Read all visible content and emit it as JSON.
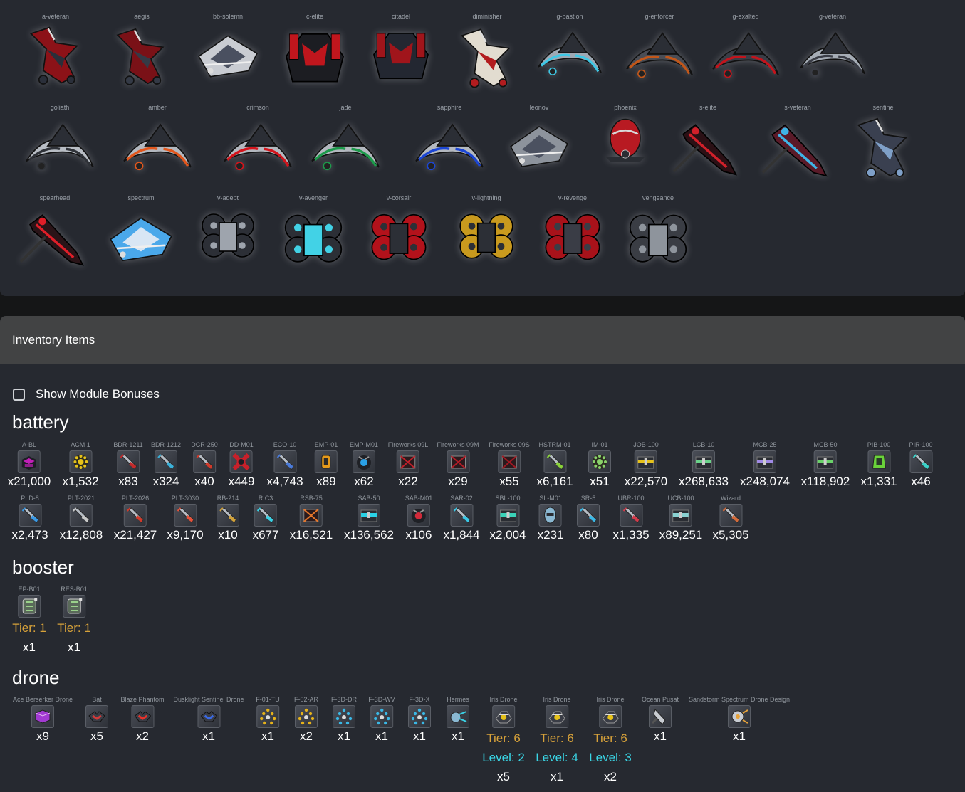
{
  "ships": [
    {
      "name": "a-veteran",
      "style": "fighter",
      "colors": [
        "#8c1218",
        "#2a2f3a"
      ]
    },
    {
      "name": "aegis",
      "style": "fighter",
      "colors": [
        "#7a1117",
        "#343a46"
      ]
    },
    {
      "name": "bb-solemn",
      "style": "cruiser",
      "colors": [
        "#c9ccd2",
        "#4a5060"
      ]
    },
    {
      "name": "c-elite",
      "style": "heavy",
      "colors": [
        "#1c1d22",
        "#c0161d"
      ]
    },
    {
      "name": "citadel",
      "style": "heavy",
      "colors": [
        "#232731",
        "#a0151b"
      ]
    },
    {
      "name": "diminisher",
      "style": "fighter",
      "colors": [
        "#e2dcd0",
        "#b21c1f"
      ]
    },
    {
      "name": "g-bastion",
      "style": "crescent",
      "colors": [
        "#9ea9b4",
        "#3ec8e6"
      ]
    },
    {
      "name": "g-enforcer",
      "style": "crescent",
      "colors": [
        "#4a4d55",
        "#c2571a"
      ]
    },
    {
      "name": "g-exalted",
      "style": "crescent",
      "colors": [
        "#3a3d46",
        "#c3141c"
      ]
    },
    {
      "name": "g-veteran",
      "style": "crescent",
      "colors": [
        "#a5acb5",
        "#3a3d46"
      ]
    },
    {
      "name": "goliath",
      "style": "crescent",
      "colors": [
        "#b8bdc4",
        "#2f3238"
      ]
    },
    {
      "name": "amber",
      "style": "crescent",
      "colors": [
        "#b3b8bf",
        "#e2561c"
      ]
    },
    {
      "name": "crimson",
      "style": "crescent",
      "colors": [
        "#b3b8bf",
        "#d4141c"
      ]
    },
    {
      "name": "jade",
      "style": "crescent",
      "colors": [
        "#b3b8bf",
        "#1c9a4a"
      ]
    },
    {
      "name": "sapphire",
      "style": "crescent",
      "colors": [
        "#b3b8bf",
        "#1c46d4"
      ]
    },
    {
      "name": "leonov",
      "style": "cruiser",
      "colors": [
        "#8d939c",
        "#4b5160"
      ]
    },
    {
      "name": "phoenix",
      "style": "pod",
      "colors": [
        "#b81a22",
        "#d8d8d8"
      ]
    },
    {
      "name": "s-elite",
      "style": "spear",
      "colors": [
        "#2b1015",
        "#d0202a"
      ]
    },
    {
      "name": "s-veteran",
      "style": "spear",
      "colors": [
        "#5a1a28",
        "#3fb4e6"
      ]
    },
    {
      "name": "sentinel",
      "style": "fighter",
      "colors": [
        "#3a4050",
        "#7fa0c8"
      ]
    },
    {
      "name": "spearhead",
      "style": "spear",
      "colors": [
        "#2a1418",
        "#e01e28"
      ]
    },
    {
      "name": "spectrum",
      "style": "cruiser",
      "colors": [
        "#4aa8ea",
        "#d8e6f4"
      ]
    },
    {
      "name": "v-adept",
      "style": "cluster",
      "colors": [
        "#2c2f36",
        "#9ea4ad"
      ]
    },
    {
      "name": "v-avenger",
      "style": "cluster",
      "colors": [
        "#2c2f36",
        "#42d2e6"
      ]
    },
    {
      "name": "v-corsair",
      "style": "cluster",
      "colors": [
        "#b3121b",
        "#2c2f36"
      ]
    },
    {
      "name": "v-lightning",
      "style": "cluster",
      "colors": [
        "#c99a1e",
        "#2c2f36"
      ]
    },
    {
      "name": "v-revenge",
      "style": "cluster",
      "colors": [
        "#a8121a",
        "#3a3d46"
      ]
    },
    {
      "name": "vengeance",
      "style": "cluster",
      "colors": [
        "#3a3d44",
        "#8e949c"
      ]
    }
  ],
  "inventory": {
    "title": "Inventory Items",
    "module_bonus_label": "Show Module Bonuses",
    "categories": [
      {
        "title": "battery",
        "rows": [
          [
            {
              "name": "A-BL",
              "count": "x21,000",
              "icon": "box",
              "color": "#c21fb8"
            },
            {
              "name": "ACM 1",
              "count": "x1,532",
              "icon": "mine",
              "color": "#e6c21a"
            },
            {
              "name": "BDR-1211",
              "count": "x83",
              "icon": "rocket",
              "color": "#c42a2a"
            },
            {
              "name": "BDR-1212",
              "count": "x324",
              "icon": "rocket",
              "color": "#3ab0d8"
            },
            {
              "name": "DCR-250",
              "count": "x40",
              "icon": "rocket",
              "color": "#d23a2a"
            },
            {
              "name": "DD-M01",
              "count": "x449",
              "icon": "cross",
              "color": "#c8202a"
            },
            {
              "name": "ECO-10",
              "count": "x4,743",
              "icon": "rocket",
              "color": "#4a7ad8"
            },
            {
              "name": "EMP-01",
              "count": "x89",
              "icon": "grenade",
              "color": "#e69a1a"
            },
            {
              "name": "EMP-M01",
              "count": "x62",
              "icon": "orb",
              "color": "#2aa0e6"
            },
            {
              "name": "Fireworks 09L",
              "count": "x22",
              "icon": "crate",
              "color": "#c0202a"
            },
            {
              "name": "Fireworks 09M",
              "count": "x29",
              "icon": "crate",
              "color": "#b01c26"
            },
            {
              "name": "Fireworks 09S",
              "count": "x55",
              "icon": "crate",
              "color": "#a01822"
            },
            {
              "name": "HSTRM-01",
              "count": "x6,161",
              "icon": "rocket",
              "color": "#8ad23a"
            },
            {
              "name": "IM-01",
              "count": "x51",
              "icon": "mine",
              "color": "#8ad26a"
            },
            {
              "name": "JOB-100",
              "count": "x22,570",
              "icon": "chest",
              "color": "#e6c21a"
            },
            {
              "name": "LCB-10",
              "count": "x268,633",
              "icon": "chest",
              "color": "#6ad28a"
            },
            {
              "name": "MCB-25",
              "count": "x248,074",
              "icon": "chest",
              "color": "#a08ae6"
            },
            {
              "name": "MCB-50",
              "count": "x118,902",
              "icon": "chest",
              "color": "#6ad26a"
            },
            {
              "name": "PIB-100",
              "count": "x1,331",
              "icon": "cell",
              "color": "#6ad23a"
            },
            {
              "name": "PIR-100",
              "count": "x46",
              "icon": "rocket",
              "color": "#3ad2c8"
            }
          ],
          [
            {
              "name": "PLD-8",
              "count": "x2,473",
              "icon": "rocket",
              "color": "#3a9ae6"
            },
            {
              "name": "PLT-2021",
              "count": "x12,808",
              "icon": "rocket",
              "color": "#c8c8c8"
            },
            {
              "name": "PLT-2026",
              "count": "x21,427",
              "icon": "rocket",
              "color": "#d23a2a"
            },
            {
              "name": "PLT-3030",
              "count": "x9,170",
              "icon": "rocket",
              "color": "#e6523a"
            },
            {
              "name": "RB-214",
              "count": "x10",
              "icon": "rocket",
              "color": "#d2a23a"
            },
            {
              "name": "RIC3",
              "count": "x677",
              "icon": "rocket",
              "color": "#3ad2e6"
            },
            {
              "name": "RSB-75",
              "count": "x16,521",
              "icon": "crate",
              "color": "#e6762a"
            },
            {
              "name": "SAB-50",
              "count": "x136,562",
              "icon": "chest",
              "color": "#2ad2e6"
            },
            {
              "name": "SAB-M01",
              "count": "x106",
              "icon": "orb",
              "color": "#d22a3a"
            },
            {
              "name": "SAR-02",
              "count": "x1,844",
              "icon": "rocket",
              "color": "#3ac8e6"
            },
            {
              "name": "SBL-100",
              "count": "x2,004",
              "icon": "chest",
              "color": "#3ad2b8"
            },
            {
              "name": "SL-M01",
              "count": "x231",
              "icon": "pod",
              "color": "#8ab8d2"
            },
            {
              "name": "SR-5",
              "count": "x80",
              "icon": "rocket",
              "color": "#3ab8e6"
            },
            {
              "name": "UBR-100",
              "count": "x1,335",
              "icon": "rocket",
              "color": "#d23a4a"
            },
            {
              "name": "UCB-100",
              "count": "x89,251",
              "icon": "chest",
              "color": "#8ad2d2"
            },
            {
              "name": "Wizard",
              "count": "x5,305",
              "icon": "rocket",
              "color": "#d26a3a"
            }
          ]
        ]
      },
      {
        "title": "booster",
        "items": [
          {
            "name": "EP-B01",
            "tier": "Tier: 1",
            "count": "x1",
            "icon": "booster",
            "color": "#9ad28a"
          },
          {
            "name": "RES-B01",
            "tier": "Tier: 1",
            "count": "x1",
            "icon": "booster",
            "color": "#9ad28a"
          }
        ]
      },
      {
        "title": "drone",
        "items": [
          {
            "name": "Ace Berserker Drone",
            "count": "x9",
            "icon": "dronebox",
            "color": "#a23ad2"
          },
          {
            "name": "Bat",
            "count": "x5",
            "icon": "dronebat",
            "color": "#d23a3a"
          },
          {
            "name": "Blaze Phantom",
            "count": "x2",
            "icon": "dronebat",
            "color": "#e6322a"
          },
          {
            "name": "Dusklight Sentinel Drone",
            "count": "x1",
            "icon": "dronebat",
            "color": "#3a6ae6"
          },
          {
            "name": "F-01-TU",
            "count": "x1",
            "icon": "formation",
            "color": "#e6b21a"
          },
          {
            "name": "F-02-AR",
            "count": "x2",
            "icon": "formation",
            "color": "#e6b21a"
          },
          {
            "name": "F-3D-DR",
            "count": "x1",
            "icon": "formation",
            "color": "#3ab8e6"
          },
          {
            "name": "F-3D-WV",
            "count": "x1",
            "icon": "formation",
            "color": "#3ab8e6"
          },
          {
            "name": "F-3D-X",
            "count": "x1",
            "icon": "formation",
            "color": "#3ab8e6"
          },
          {
            "name": "Hermes",
            "count": "x1",
            "icon": "hermes",
            "color": "#3ad2e6"
          },
          {
            "name": "Iris Drone",
            "tier": "Tier: 6",
            "level": "Level: 2",
            "count": "x5",
            "icon": "iris",
            "color": "#e6c21a"
          },
          {
            "name": "Iris Drone",
            "tier": "Tier: 6",
            "level": "Level: 4",
            "count": "x1",
            "icon": "iris",
            "color": "#e6c21a"
          },
          {
            "name": "Iris Drone",
            "tier": "Tier: 6",
            "level": "Level: 3",
            "count": "x2",
            "icon": "iris",
            "color": "#e6c21a"
          },
          {
            "name": "Ocean Pusat",
            "count": "x1",
            "icon": "ocean",
            "color": "#c8ccd2"
          },
          {
            "name": "Sandstorm Spectrum Drone Design",
            "count": "x1",
            "icon": "sandstorm",
            "color": "#e6a23a"
          }
        ]
      }
    ]
  }
}
